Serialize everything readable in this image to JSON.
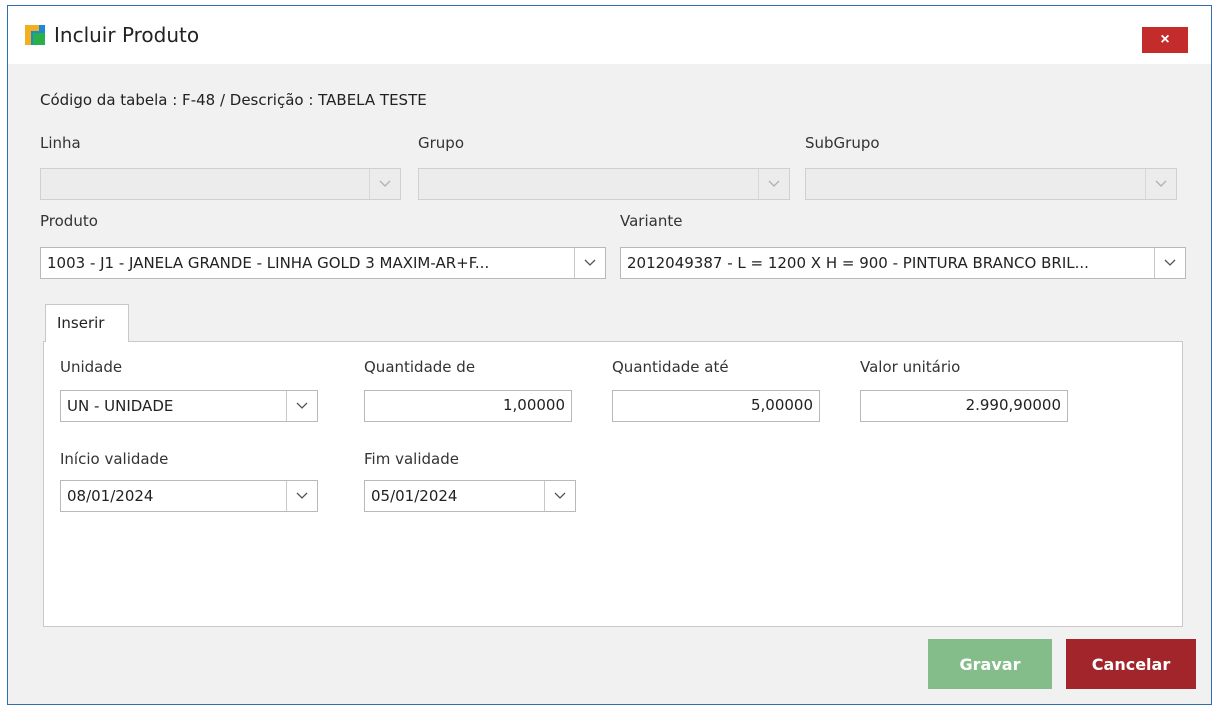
{
  "window": {
    "title": "Incluir Produto",
    "close_label": "×"
  },
  "info_line": "Código da tabela : F-48  / Descrição : TABELA TESTE",
  "filters": {
    "linha": {
      "label": "Linha",
      "value": ""
    },
    "grupo": {
      "label": "Grupo",
      "value": ""
    },
    "subgrupo": {
      "label": "SubGrupo",
      "value": ""
    }
  },
  "produto": {
    "label": "Produto",
    "value": "1003 - J1 - JANELA GRANDE - LINHA  GOLD 3 MAXIM-AR+F..."
  },
  "variante": {
    "label": "Variante",
    "value": "2012049387 - L = 1200 X H = 900 - PINTURA BRANCO BRIL..."
  },
  "tab": {
    "label": "Inserir"
  },
  "form": {
    "unidade": {
      "label": "Unidade",
      "value": "UN - UNIDADE"
    },
    "quantidade_de": {
      "label": "Quantidade de",
      "value": "1,00000"
    },
    "quantidade_ate": {
      "label": "Quantidade até",
      "value": "5,00000"
    },
    "valor_unitario": {
      "label": "Valor unitário",
      "value": "2.990,90000"
    },
    "inicio_validade": {
      "label": "Início validade",
      "value": "08/01/2024"
    },
    "fim_validade": {
      "label": "Fim validade",
      "value": "05/01/2024"
    }
  },
  "buttons": {
    "save": "Gravar",
    "cancel": "Cancelar"
  },
  "colors": {
    "window_border": "#2e6fb4",
    "close": "#c42b2b",
    "save": "#84bd8a",
    "cancel": "#a3252c"
  }
}
